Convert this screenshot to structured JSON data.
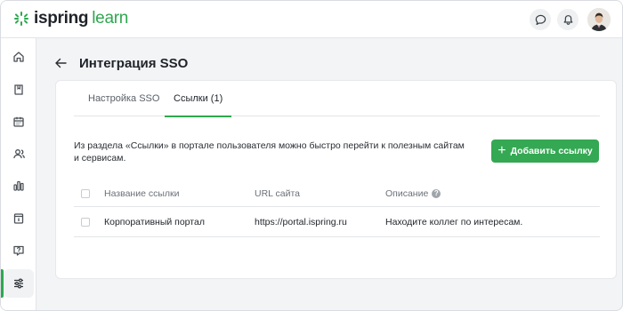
{
  "app": {
    "logo_name": "ispring",
    "logo_suffix": "learn",
    "brand_color": "#2ea84f"
  },
  "topbar": {
    "icons": [
      "chat-icon",
      "bell-icon"
    ]
  },
  "sidebar": {
    "items": [
      {
        "icon": "home-icon"
      },
      {
        "icon": "book-icon"
      },
      {
        "icon": "calendar-icon"
      },
      {
        "icon": "users-icon"
      },
      {
        "icon": "chart-icon"
      },
      {
        "icon": "info-card-icon"
      },
      {
        "icon": "help-icon"
      },
      {
        "icon": "settings-sliders-icon",
        "active": true
      }
    ]
  },
  "page": {
    "title": "Интеграция SSO"
  },
  "tabs": [
    {
      "label": "Настройка SSO"
    },
    {
      "label": "Ссылки (1)",
      "active": true
    }
  ],
  "description": "Из раздела «Ссылки» в портале пользователя можно быстро перейти к полезным сайтам и сервисам.",
  "add_button": {
    "icon": "+",
    "label": "Добавить ссылку",
    "color": "#34a853"
  },
  "table": {
    "columns": [
      "Название ссылки",
      "URL сайта",
      "Описание"
    ],
    "help_icon": "?",
    "rows": [
      {
        "name": "Корпоративный портал",
        "url": "https://portal.ispring.ru",
        "description": "Находите коллег по интересам."
      }
    ]
  }
}
